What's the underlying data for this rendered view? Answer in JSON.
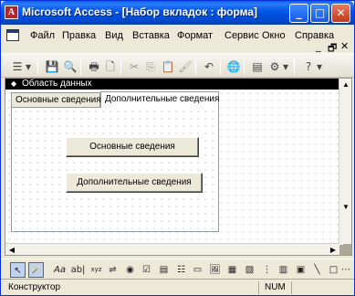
{
  "window": {
    "title": "Microsoft Access - [Набор вкладок : форма]",
    "app_icon_letter": "A",
    "minimize": "_",
    "maximize": "□",
    "close": "✕"
  },
  "menu": {
    "items": [
      "Файл",
      "Правка",
      "Вид",
      "Вставка",
      "Формат",
      "Сервис",
      "Окно",
      "Справка"
    ],
    "help_box": "?",
    "mdi_minimize": "_",
    "mdi_restore": "🗗",
    "mdi_close": "✕"
  },
  "toolbar": {
    "icons": [
      "form-view-icon",
      "dropdown-arrow-icon",
      "save-icon",
      "search-file-icon",
      "print-icon",
      "print-preview-icon",
      "cut-icon",
      "copy-icon",
      "paste-icon",
      "format-painter-icon",
      "undo-icon",
      "hyperlink-icon",
      "field-list-icon",
      "properties-icon",
      "help-icon"
    ],
    "glyphs": {
      "view": "☰",
      "drop": "▾",
      "save": "💾",
      "search": "🔍",
      "print": "🖶",
      "preview": "🗋",
      "cut": "✂",
      "copy": "⎘",
      "paste": "📋",
      "painter": "🖌",
      "undo": "↶",
      "link": "🌐",
      "fieldlist": "▤",
      "props": "⚙",
      "help": "?"
    }
  },
  "form": {
    "section_title": "Область данных",
    "section_arrow": "◆",
    "tabs": [
      "Основные сведения",
      "Дополнительные сведения"
    ],
    "active_tab": 1,
    "buttons": [
      "Основные сведения",
      "Дополнительные сведения"
    ]
  },
  "scrollbars": {
    "up": "▲",
    "down": "▼",
    "left": "◀",
    "right": "▶"
  },
  "toolbox": {
    "tools": [
      "select-objects-icon",
      "control-wizards-icon",
      "label-icon",
      "text-box-icon",
      "option-group-icon",
      "toggle-button-icon",
      "option-button-icon",
      "check-box-icon",
      "combo-box-icon",
      "list-box-icon",
      "command-button-icon",
      "image-icon",
      "unbound-object-frame-icon",
      "bound-object-frame-icon",
      "page-break-icon",
      "tab-control-icon",
      "subform-icon",
      "line-icon",
      "rectangle-icon",
      "more-controls-icon"
    ],
    "glyphs": {
      "select": "↖",
      "wizard": "🪄",
      "label": "Aa",
      "textbox": "ab|",
      "group": "xyz",
      "toggle": "⇌",
      "option": "◉",
      "check": "☑",
      "combo": "▤",
      "list": "☷",
      "cmd": "▭",
      "image": "🖼",
      "unbound": "▦",
      "bound": "▧",
      "pagebreak": "⋮",
      "tabctl": "▥",
      "subform": "▣",
      "line": "╲",
      "rect": "□",
      "more": "⋯"
    }
  },
  "status": {
    "mode": "Конструктор",
    "num": "NUM"
  }
}
